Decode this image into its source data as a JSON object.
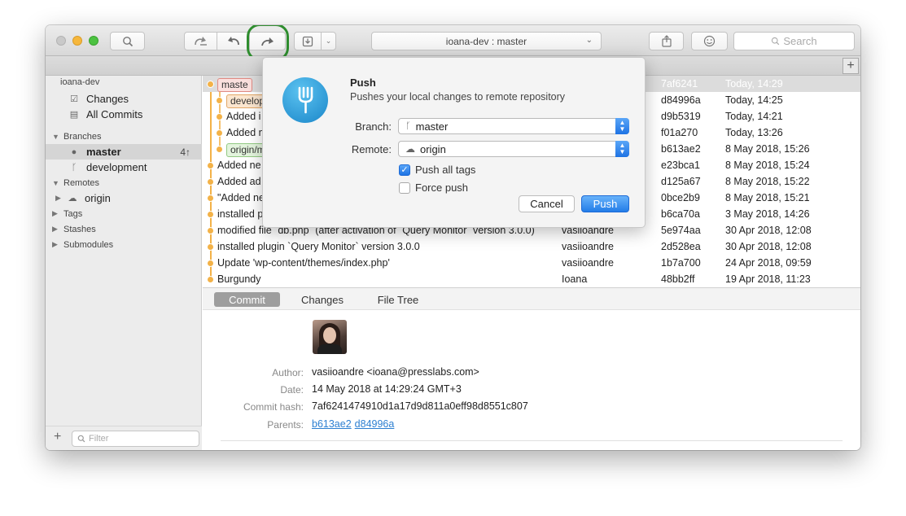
{
  "toolbar": {
    "repo_branch": "ioana-dev : master",
    "search_placeholder": "Search"
  },
  "sidebar": {
    "repo_name": "ioana-dev",
    "changes": "Changes",
    "all_commits": "All Commits",
    "branches_header": "Branches",
    "branches": [
      {
        "name": "master",
        "count": "4↑"
      },
      {
        "name": "development"
      }
    ],
    "remotes_header": "Remotes",
    "remote_origin": "origin",
    "tags_header": "Tags",
    "stashes_header": "Stashes",
    "submodules_header": "Submodules",
    "filter_placeholder": "Filter"
  },
  "commits": [
    {
      "tag": "maste",
      "message": "",
      "author": "",
      "hash": "7af6241",
      "date": "Today, 14:29"
    },
    {
      "tag": "develop",
      "message": "",
      "author": "",
      "hash": "d84996a",
      "date": "Today, 14:25"
    },
    {
      "tag": "",
      "message": "Added i",
      "author": "",
      "hash": "d9b5319",
      "date": "Today, 14:21"
    },
    {
      "tag": "",
      "message": "Added n",
      "author": "",
      "hash": "f01a270",
      "date": "Today, 13:26"
    },
    {
      "tag": "origin/m",
      "message": "",
      "author": "",
      "hash": "b613ae2",
      "date": "8 May 2018, 15:26"
    },
    {
      "tag": "",
      "message": "Added ne",
      "author": "",
      "hash": "e23bca1",
      "date": "8 May 2018, 15:24"
    },
    {
      "tag": "",
      "message": "Added ad",
      "author": "",
      "hash": "d125a67",
      "date": "8 May 2018, 15:22"
    },
    {
      "tag": "",
      "message": "\"Added ne",
      "author": "",
      "hash": "0bce2b9",
      "date": "8 May 2018, 15:21"
    },
    {
      "tag": "",
      "message": "installed p",
      "author": "",
      "hash": "b6ca70a",
      "date": "3 May 2018, 14:26"
    },
    {
      "tag": "",
      "message": "modified file `db.php` (after activation of `Query Monitor` version 3.0.0)",
      "author": "vasiioandre",
      "hash": "5e974aa",
      "date": "30 Apr 2018, 12:08"
    },
    {
      "tag": "",
      "message": "installed plugin `Query Monitor` version 3.0.0",
      "author": "vasiioandre",
      "hash": "2d528ea",
      "date": "30 Apr 2018, 12:08"
    },
    {
      "tag": "",
      "message": "Update 'wp-content/themes/index.php'",
      "author": "vasiioandre",
      "hash": "1b7a700",
      "date": "24 Apr 2018, 09:59"
    },
    {
      "tag": "",
      "message": "Burgundy",
      "author": "Ioana",
      "hash": "48bb2ff",
      "date": "19 Apr 2018, 11:23"
    }
  ],
  "detail_tabs": [
    "Commit",
    "Changes",
    "File Tree"
  ],
  "detail": {
    "author_label": "Author:",
    "author_value": "vasiioandre <ioana@presslabs.com>",
    "date_label": "Date:",
    "date_value": "14 May 2018 at 14:29:24 GMT+3",
    "hash_label": "Commit hash:",
    "hash_value": "7af6241474910d1a17d9d811a0eff98d8551c807",
    "parents_label": "Parents:",
    "parent1": "b613ae2",
    "parent2": "d84996a"
  },
  "push_dialog": {
    "title": "Push",
    "subtitle": "Pushes your local changes to remote repository",
    "branch_label": "Branch:",
    "branch_value": "master",
    "remote_label": "Remote:",
    "remote_value": "origin",
    "push_tags_label": "Push all tags",
    "push_tags_checked": true,
    "force_push_label": "Force push",
    "force_push_checked": false,
    "cancel_label": "Cancel",
    "push_label": "Push"
  },
  "colors": {
    "accent": "#237de8",
    "graph": "#f3b248",
    "highlight_ring": "#2f8d2f"
  }
}
